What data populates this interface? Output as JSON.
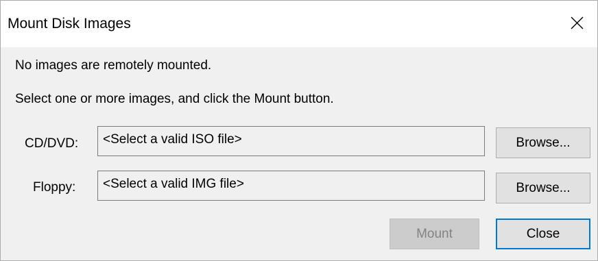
{
  "window": {
    "title": "Mount Disk Images"
  },
  "messages": {
    "status": "No images are remotely mounted.",
    "instruction": "Select one or more images, and click the Mount button."
  },
  "cd": {
    "label": "CD/DVD:",
    "placeholder": "<Select a valid ISO file>",
    "browse_label": "Browse..."
  },
  "floppy": {
    "label": "Floppy:",
    "placeholder": "<Select a valid IMG file>",
    "browse_label": "Browse..."
  },
  "actions": {
    "mount_label": "Mount",
    "mount_enabled": false,
    "close_label": "Close"
  },
  "icons": {
    "close": "close-icon"
  },
  "colors": {
    "focus_border": "#0078d7",
    "disabled_text": "#838383"
  }
}
